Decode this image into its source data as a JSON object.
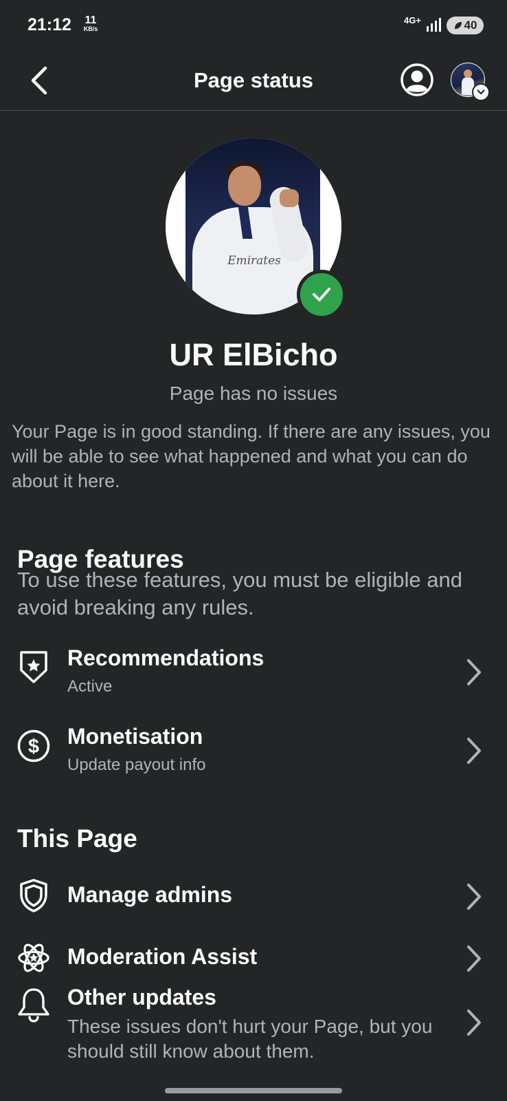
{
  "status_bar": {
    "time": "21:12",
    "net_speed_value": "11",
    "net_speed_unit": "KB/s",
    "network_type": "4G+",
    "battery": "40"
  },
  "header": {
    "title": "Page status"
  },
  "profile": {
    "name": "UR ElBicho",
    "status": "Page has no issues",
    "photo_sponsor_text": "Emirates",
    "description": "Your Page is in good standing. If there are any issues, you will be able to see what happened and what you can do about it here."
  },
  "page_features": {
    "title": "Page features",
    "subtitle": "To use these features, you must be eligible and avoid breaking any rules.",
    "items": [
      {
        "label": "Recommendations",
        "sub": "Active",
        "icon": "shield-star-icon"
      },
      {
        "label": "Monetisation",
        "sub": "Update payout info",
        "icon": "dollar-circle-icon"
      }
    ]
  },
  "this_page": {
    "title": "This Page",
    "items": [
      {
        "label": "Manage admins",
        "icon": "shield-icon"
      },
      {
        "label": "Moderation Assist",
        "icon": "moderation-icon"
      },
      {
        "label": "Other updates",
        "sub": "These issues don't hurt your Page, but you should still know about them.",
        "icon": "bell-icon"
      }
    ]
  },
  "colors": {
    "background": "#242526",
    "verified_green": "#31a24c",
    "secondary_text": "#b0b3b8"
  }
}
